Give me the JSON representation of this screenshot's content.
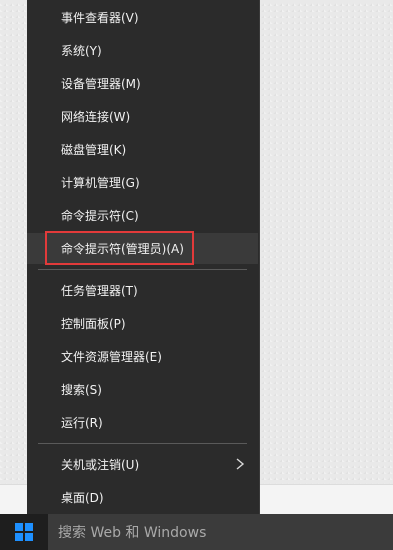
{
  "context_menu": {
    "items": [
      {
        "label": "事件查看器(V)"
      },
      {
        "label": "系统(Y)"
      },
      {
        "label": "设备管理器(M)"
      },
      {
        "label": "网络连接(W)"
      },
      {
        "label": "磁盘管理(K)"
      },
      {
        "label": "计算机管理(G)"
      },
      {
        "label": "命令提示符(C)"
      },
      {
        "label": "命令提示符(管理员)(A)"
      },
      {
        "label": "任务管理器(T)"
      },
      {
        "label": "控制面板(P)"
      },
      {
        "label": "文件资源管理器(E)"
      },
      {
        "label": "搜索(S)"
      },
      {
        "label": "运行(R)"
      },
      {
        "label": "关机或注销(U)"
      },
      {
        "label": "桌面(D)"
      }
    ],
    "highlighted_item": "命令提示符(管理员)(A)",
    "highlight_color": "#e23a3a"
  },
  "taskbar": {
    "start_icon": "windows-logo-icon",
    "search_placeholder": "搜索 Web 和 Windows"
  },
  "colors": {
    "menu_background": "#2b2b2b",
    "menu_text": "#f2f2f2",
    "taskbar_background": "#1e1e1e",
    "search_background": "#3b3b3b",
    "windows_logo": "#1e90ff"
  }
}
